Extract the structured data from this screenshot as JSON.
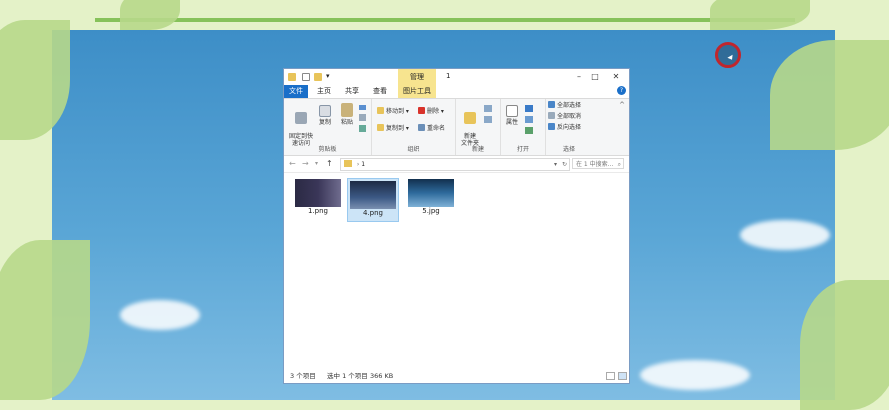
{
  "window": {
    "title": "1",
    "manage_tab": "管理",
    "controls": {
      "minimize": "–",
      "maximize": "□",
      "close": "✕"
    },
    "tabs": [
      "文件",
      "主页",
      "共享",
      "查看",
      "图片工具"
    ],
    "help_icon": "?"
  },
  "ribbon": {
    "clipboard": {
      "label": "剪贴板",
      "pin": "固定到快\n速访问",
      "copy": "复制",
      "paste": "粘贴"
    },
    "organize": {
      "label": "组织",
      "move_to": "移动到 ▾",
      "copy_to": "复制到 ▾",
      "delete": "删除 ▾",
      "rename": "重命名"
    },
    "new": {
      "label": "新建",
      "new_folder": "新建\n文件夹"
    },
    "open": {
      "label": "打开",
      "properties": "属性"
    },
    "select": {
      "label": "选择",
      "select_all": "全部选择",
      "select_none": "全部取消",
      "invert": "反向选择"
    }
  },
  "address": {
    "path": "1",
    "search_placeholder": "在 1 中搜索..."
  },
  "files": [
    {
      "name": "1.png",
      "selected": false
    },
    {
      "name": "4.png",
      "selected": true
    },
    {
      "name": "5.jpg",
      "selected": false
    }
  ],
  "status": {
    "count": "3 个项目",
    "selected": "选中 1 个项目",
    "size": "366 KB"
  }
}
